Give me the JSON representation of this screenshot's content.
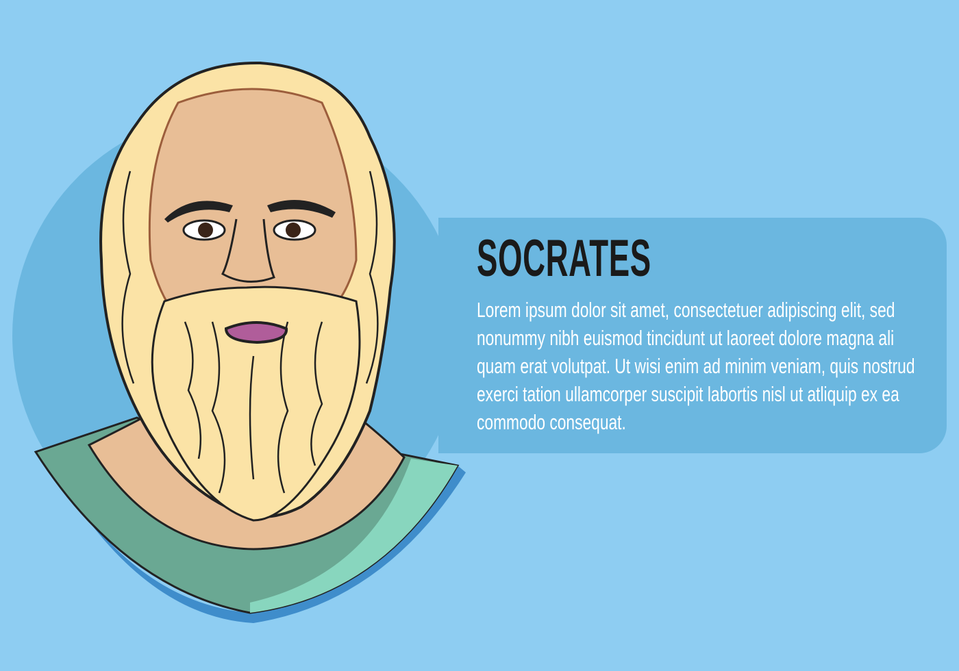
{
  "card": {
    "title": "SOCRATES",
    "body_lines": [
      "Lorem ipsum dolor sit amet, consectetuer adipiscing elit, sed",
      "nonummy nibh euismod tincidunt ut laoreet dolore magna ali",
      "quam erat volutpat. Ut wisi enim ad minim veniam, quis nostrud",
      "exerci tation ullamcorper suscipit labortis nisl ut atliquip ex ea",
      "commodo consequat."
    ]
  },
  "colors": {
    "background": "#8ECDF2",
    "circle": "#6BB7E0",
    "panel": "#6BB7E0",
    "skin": "#E8BE96",
    "hair": "#FBE3A6",
    "robe": "#6AA893",
    "robe_trim": "#88D6BE",
    "mouth": "#B05D9A"
  }
}
